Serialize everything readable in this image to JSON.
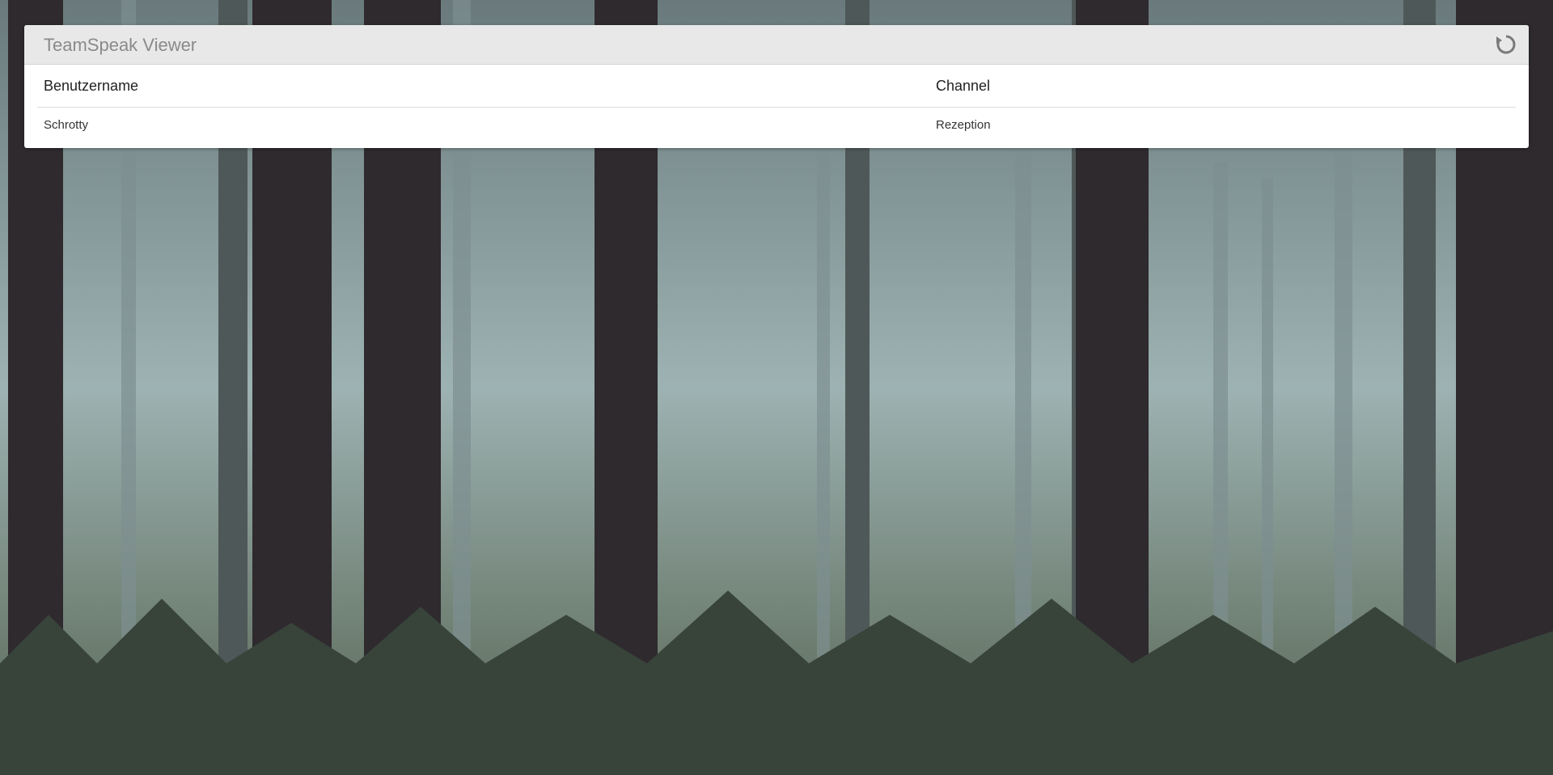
{
  "app": {
    "title": "TeamSpeak Viewer",
    "refresh_icon": "refresh-icon"
  },
  "table": {
    "headers": {
      "username": "Benutzername",
      "channel": "Channel"
    },
    "rows": [
      {
        "username": "Schrotty",
        "channel": "Rezeption"
      }
    ]
  },
  "colors": {
    "header_bg": "#e8e8e8",
    "panel_bg": "#ffffff",
    "title_text": "#8a8a8a"
  }
}
